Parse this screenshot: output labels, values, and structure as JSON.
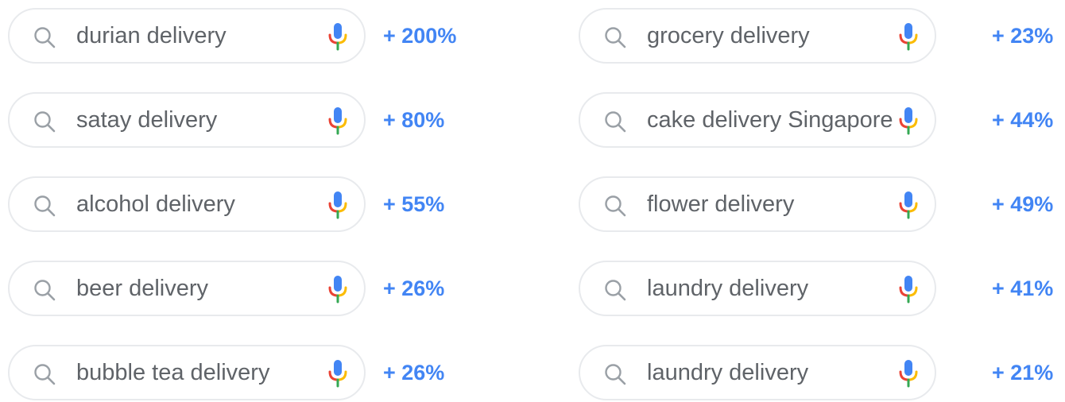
{
  "left_column": [
    {
      "query": "durian delivery",
      "growth": "+ 200%"
    },
    {
      "query": "satay delivery",
      "growth": "+ 80%"
    },
    {
      "query": "alcohol delivery",
      "growth": "+ 55%"
    },
    {
      "query": "beer delivery",
      "growth": "+ 26%"
    },
    {
      "query": "bubble tea delivery",
      "growth": "+ 26%"
    }
  ],
  "right_column": [
    {
      "query": "grocery delivery",
      "growth": "+ 23%"
    },
    {
      "query": "cake delivery Singapore",
      "growth": "+ 44%"
    },
    {
      "query": "flower delivery",
      "growth": "+ 49%"
    },
    {
      "query": "laundry delivery",
      "growth": "+ 41%"
    },
    {
      "query": "laundry delivery",
      "growth": "+ 21%"
    }
  ],
  "icons": {
    "search": "search-icon",
    "mic": "mic-icon"
  },
  "colors": {
    "query_text": "#5f6368",
    "growth_text": "#4285f4",
    "box_border": "#e8eaed",
    "mic_blue": "#4285f4",
    "mic_red": "#ea4335",
    "mic_yellow": "#fbbc05",
    "mic_green": "#34a853"
  }
}
